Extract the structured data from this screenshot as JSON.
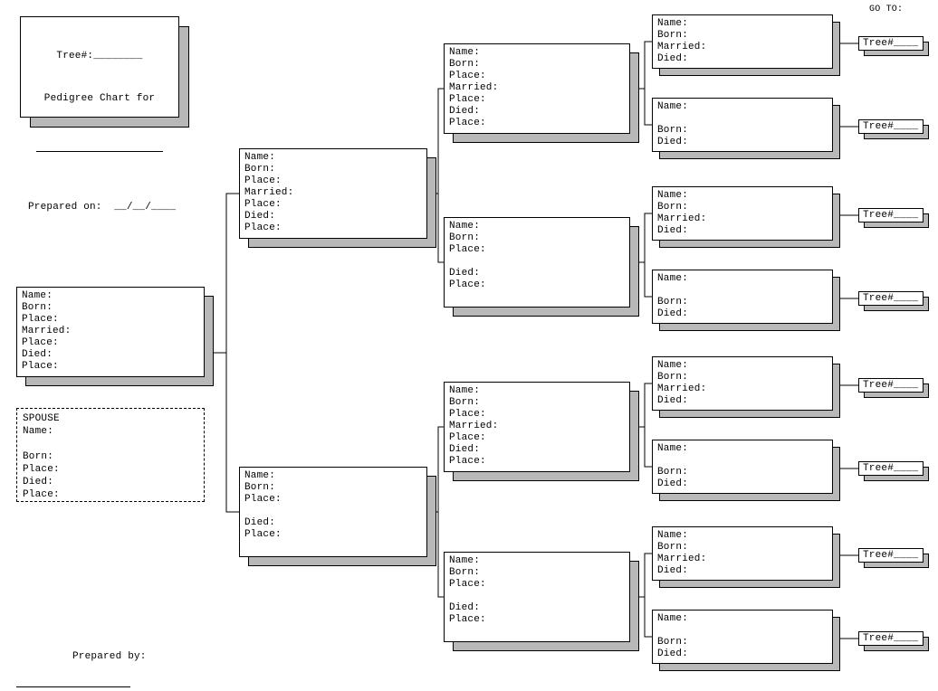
{
  "header": {
    "goto_label": "GO TO:",
    "tree_num_short": "Tree#____"
  },
  "info_box": {
    "tree_num_label": "Tree#:________",
    "title": "Pedigree Chart for",
    "prepared_on": "Prepared on:  __/__/____"
  },
  "footer": {
    "prepared_by": "Prepared by:"
  },
  "labelset_full": "Name:\nBorn:\nPlace:\nMarried:\nPlace:\nDied:\nPlace:",
  "labelset_female": "Name:\nBorn:\nPlace:\n\nDied:\nPlace:",
  "labelset_gen4_male": "Name:\nBorn:\nMarried:\nDied:",
  "labelset_gen4_female": "Name:\n\nBorn:\nDied:",
  "spouse_box": "SPOUSE\nName:\n\nBorn:\nPlace:\nDied:\nPlace:"
}
